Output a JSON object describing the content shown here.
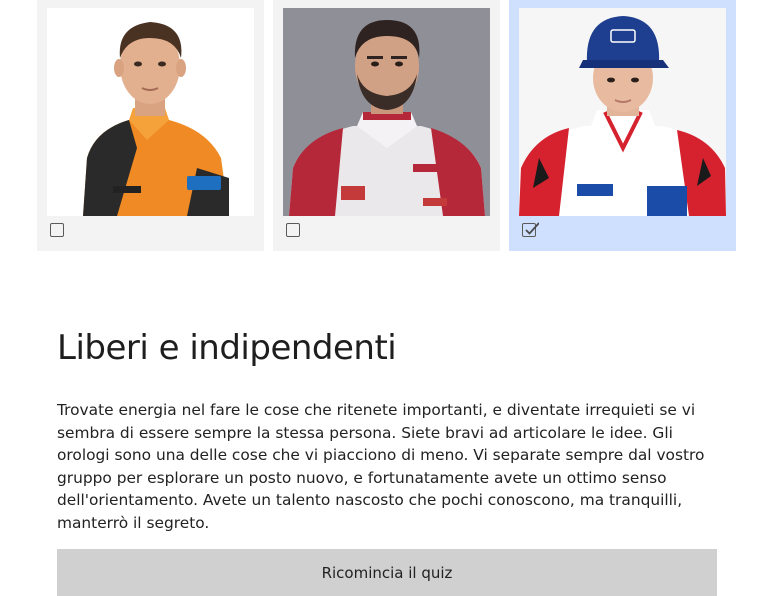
{
  "quiz": {
    "options": [
      {
        "id": "driver-1",
        "image": "driver-photo-orange-suit",
        "selected": false
      },
      {
        "id": "driver-2",
        "image": "driver-photo-white-red-suit",
        "selected": false
      },
      {
        "id": "driver-3",
        "image": "driver-photo-cap-white-suit",
        "selected": true
      }
    ]
  },
  "result": {
    "title": "Liberi e indipendenti",
    "description": "Trovate energia nel fare le cose che ritenete importanti, e diventate irrequieti se vi sembra di essere sempre la stessa persona. Siete bravi ad articolare le idee. Gli orologi sono una delle cose che vi piacciono di meno. Vi separate sempre dal vostro gruppo per esplorare un posto nuovo, e fortunatamente avete un ottimo senso dell'orientamento. Avete un talento nascosto che pochi conoscono, ma tranquilli, manterrò il segreto.",
    "restart_label": "Ricomincia il quiz"
  },
  "colors": {
    "card_bg": "#f3f3f3",
    "card_selected_bg": "#cfe0ff",
    "button_bg": "#d0d0d0"
  }
}
